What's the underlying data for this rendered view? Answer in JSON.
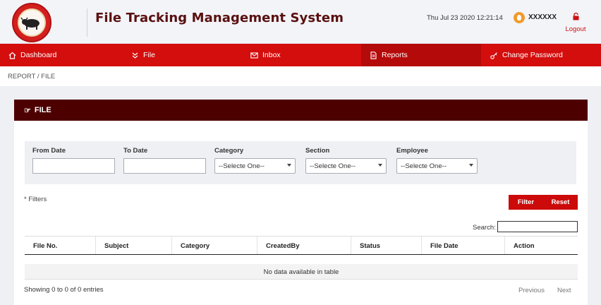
{
  "header": {
    "title": "File Tracking Management System",
    "datetime": "Thu Jul 23 2020 12:21:14",
    "user": "XXXXXX",
    "logout": "Logout"
  },
  "nav": [
    {
      "label": "Dashboard",
      "icon": "home-icon"
    },
    {
      "label": "File",
      "icon": "chevrons-down-icon"
    },
    {
      "label": "Inbox",
      "icon": "envelope-icon"
    },
    {
      "label": "Reports",
      "icon": "document-icon"
    },
    {
      "label": "Change Password",
      "icon": "key-icon"
    }
  ],
  "breadcrumb": "REPORT  /  FILE",
  "panel": {
    "title": "FILE",
    "filters": {
      "from_date": {
        "label": "From Date",
        "value": ""
      },
      "to_date": {
        "label": "To Date",
        "value": ""
      },
      "category": {
        "label": "Category",
        "selected": "--Selecte One--"
      },
      "section": {
        "label": "Section",
        "selected": "--Selecte One--"
      },
      "employee": {
        "label": "Employee",
        "selected": "--Selecte One--"
      }
    },
    "filters_note": "* Filters",
    "buttons": {
      "filter": "Filter",
      "reset": "Reset"
    },
    "search_label": "Search:",
    "table": {
      "columns": [
        "File No.",
        "Subject",
        "Category",
        "CreatedBy",
        "Status",
        "File Date",
        "Action"
      ],
      "empty": "No data available in table"
    },
    "info": "Showing 0 to 0 of 0 entries",
    "pagination": {
      "previous": "Previous",
      "next": "Next"
    }
  },
  "colors": {
    "brand_red": "#d40d0d",
    "panel_header": "#4d0000",
    "title": "#5a1010"
  }
}
